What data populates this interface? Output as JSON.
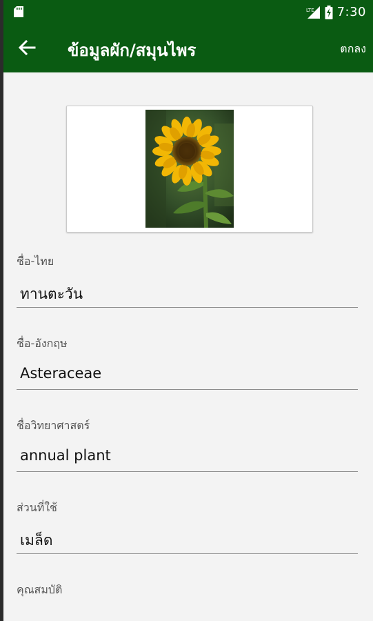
{
  "statusbar": {
    "time": "7:30",
    "network": "LTE"
  },
  "appbar": {
    "title": "ข้อมูลผัก/สมุนไพร",
    "ok_label": "ตกลง"
  },
  "image": {
    "alt": "sunflower-photo"
  },
  "fields": [
    {
      "label": "ชื่อ-ไทย",
      "value": "ทานตะวัน"
    },
    {
      "label": "ชื่อ-อังกฤษ",
      "value": "Asteraceae"
    },
    {
      "label": "ชื่อวิทยาศาสตร์",
      "value": "annual plant"
    },
    {
      "label": "ส่วนที่ใช้",
      "value": "เมล็ด"
    },
    {
      "label": "คุณสมบัติ",
      "value": ""
    }
  ],
  "colors": {
    "appbar": "#0a5b12",
    "background": "#f3f3f3"
  }
}
